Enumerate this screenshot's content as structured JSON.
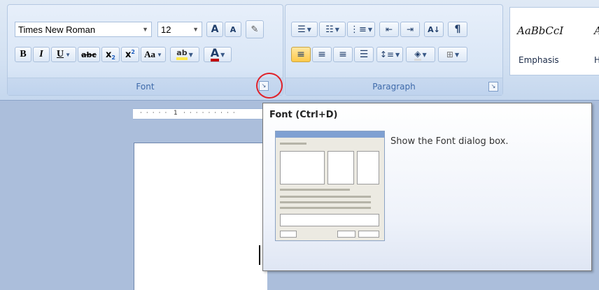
{
  "font_group": {
    "font_name": "Times New Roman",
    "font_size": "12",
    "grow_label": "A",
    "shrink_label": "A",
    "bold": "B",
    "italic": "I",
    "underline": "U",
    "strikethrough": "abc",
    "subscript": "x",
    "superscript": "x",
    "change_case": "Aa",
    "font_color": "A",
    "label": "Font",
    "launcher_label": "↘"
  },
  "paragraph_group": {
    "label": "Paragraph",
    "sort_label": "A↓",
    "show_marks": "¶",
    "launcher_label": "↘"
  },
  "styles": {
    "sample": "AaBbCcI",
    "name": "Emphasis",
    "next_sample": "A",
    "next_name": "H"
  },
  "ruler": {
    "mark": "1"
  },
  "tooltip": {
    "title": "Font (Ctrl+D)",
    "description": "Show the Font dialog box."
  },
  "colors": {
    "highlight_ring": "#e0222a",
    "accent_blue": "#3e6aaa",
    "highlight_yellow": "#ffe84a"
  }
}
